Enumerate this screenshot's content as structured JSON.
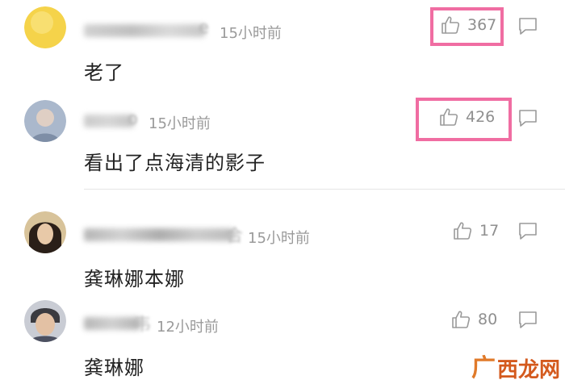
{
  "comments": [
    {
      "name_visible_suffix": "e",
      "time": "15小时前",
      "content": "老了",
      "likes": "367",
      "highlighted": true,
      "avatar_color": "#f5d34a"
    },
    {
      "name_visible_suffix": "o",
      "time": "15小时前",
      "content": "看出了点海清的影子",
      "likes": "426",
      "highlighted": true,
      "avatar_color": "#aab8cc"
    },
    {
      "name_visible_suffix": "合",
      "time": "15小时前",
      "content": "龚琳娜本娜",
      "likes": "17",
      "highlighted": false,
      "avatar_color": "#5a4634"
    },
    {
      "name_visible_suffix": "韦",
      "time": "12小时前",
      "content": "龚琳娜",
      "likes": "80",
      "highlighted": false,
      "avatar_color": "#6b6f7a"
    }
  ],
  "colors": {
    "highlight": "#f06da2",
    "meta_text": "#9a9a9a",
    "like_text": "#8f8f8f"
  },
  "icons": {
    "like": "thumbs-up-icon",
    "reply": "comment-bubble-icon"
  },
  "watermark": {
    "mark": "广",
    "text": "西龙网"
  }
}
